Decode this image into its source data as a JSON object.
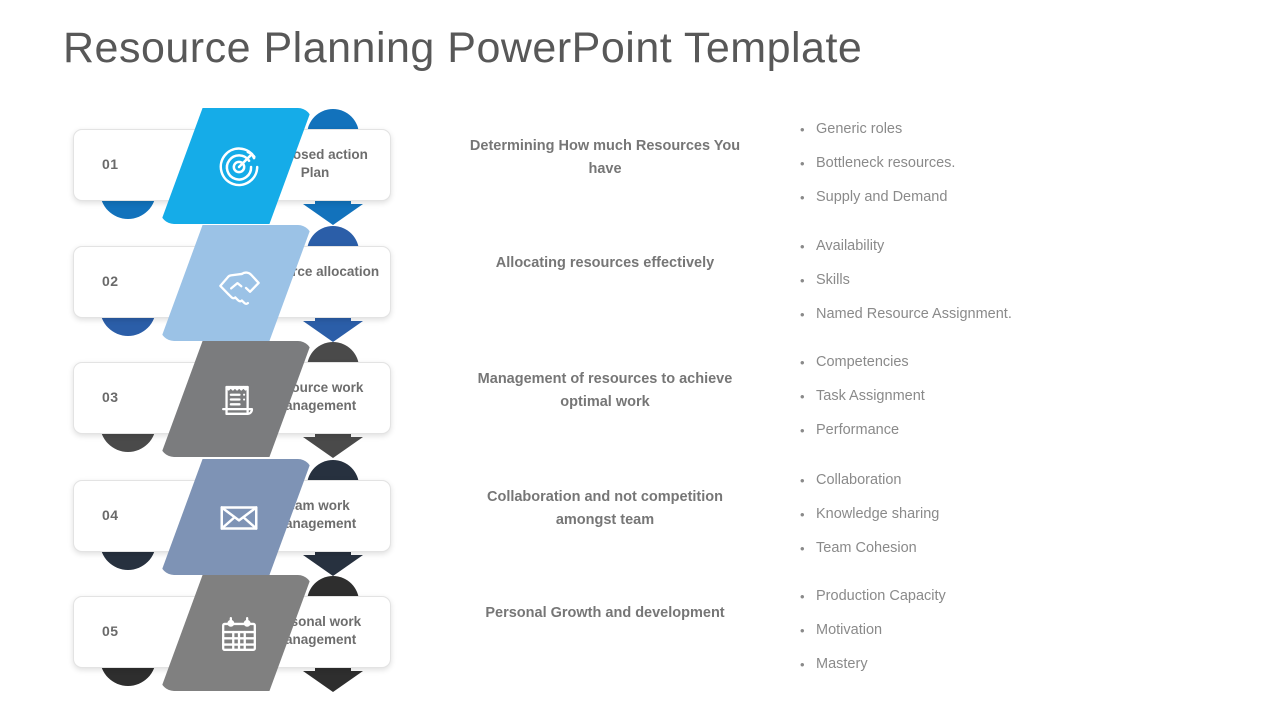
{
  "title": "Resource Planning PowerPoint Template",
  "colors": {
    "title_text": "#585858",
    "body_text": "#8a8a8a",
    "heading_text": "#767676"
  },
  "rows": [
    {
      "number": "01",
      "label": "Proposed action Plan",
      "icon": "target-icon",
      "accent": "#15ACE8",
      "accent_dark": "#1272BC",
      "description": "Determining How much Resources You have",
      "bullets": [
        "Generic roles",
        "Bottleneck resources.",
        "Supply and Demand"
      ]
    },
    {
      "number": "02",
      "label": "Resource allocation",
      "icon": "handshake-icon",
      "accent": "#9BC2E6",
      "accent_dark": "#2B5EA8",
      "description": "Allocating resources effectively",
      "bullets": [
        "Availability",
        "Skills",
        "Named Resource Assignment."
      ]
    },
    {
      "number": "03",
      "label": "Resource work Management",
      "icon": "receipt-icon",
      "accent": "#7B7C7E",
      "accent_dark": "#4A4A4A",
      "description": "Management of resources to achieve optimal work",
      "bullets": [
        "Competencies",
        "Task Assignment",
        "Performance"
      ]
    },
    {
      "number": "04",
      "label": "Team work Management",
      "icon": "envelope-icon",
      "accent": "#7E93B5",
      "accent_dark": "#27313F",
      "description": "Collaboration and not competition amongst team",
      "bullets": [
        "Collaboration",
        "Knowledge sharing",
        "Team Cohesion"
      ]
    },
    {
      "number": "05",
      "label": "Personal work Management",
      "icon": "calendar-icon",
      "accent": "#808080",
      "accent_dark": "#2E2E2E",
      "description": "Personal Growth and development",
      "bullets": [
        "Production Capacity",
        "Motivation",
        "Mastery"
      ]
    }
  ],
  "bullet_glyph": "•"
}
